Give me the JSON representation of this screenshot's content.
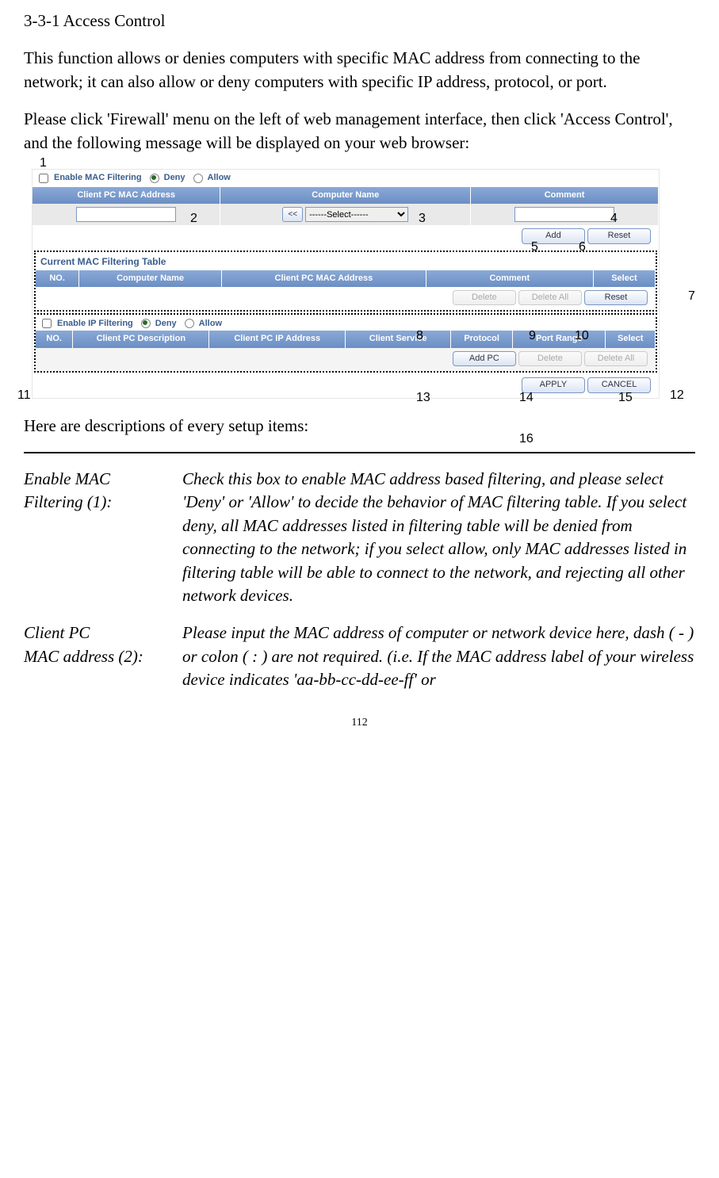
{
  "heading": "3-3-1 Access Control",
  "para1": "This function allows or denies computers with specific MAC address from connecting to the network; it can also allow or deny computers with specific IP address, protocol, or port.",
  "para2": "Please click 'Firewall' menu on the left of web management interface, then click 'Access Control', and the following message will be displayed on your web browser:",
  "para3": "Here are descriptions of every setup items:",
  "ui": {
    "macFilter": {
      "enableLabel": "Enable MAC Filtering",
      "deny": "Deny",
      "allow": "Allow",
      "headers": [
        "Client PC MAC Address",
        "Computer Name",
        "Comment"
      ],
      "selectPlaceholder": "------Select------",
      "arrow": "<<",
      "addBtn": "Add",
      "resetBtn": "Reset"
    },
    "macTable": {
      "title": "Current MAC Filtering Table",
      "headers": [
        "NO.",
        "Computer Name",
        "Client PC MAC Address",
        "Comment",
        "Select"
      ],
      "deleteBtn": "Delete",
      "deleteAllBtn": "Delete All",
      "resetBtn": "Reset"
    },
    "ipFilter": {
      "enableLabel": "Enable IP Filtering",
      "deny": "Deny",
      "allow": "Allow",
      "headers": [
        "NO.",
        "Client PC Description",
        "Client PC IP Address",
        "Client Service",
        "Protocol",
        "Port Range",
        "Select"
      ],
      "addPcBtn": "Add PC",
      "deleteBtn": "Delete",
      "deleteAllBtn": "Delete All"
    },
    "applyBtn": "APPLY",
    "cancelBtn": "CANCEL"
  },
  "callouts": {
    "c1": "1",
    "c2": "2",
    "c3": "3",
    "c4": "4",
    "c5": "5",
    "c6": "6",
    "c7": "7",
    "c8": "8",
    "c9": "9",
    "c10": "10",
    "c11": "11",
    "c12": "12",
    "c13": "13",
    "c14": "14",
    "c15": "15",
    "c16": "16"
  },
  "items": [
    {
      "name": "Enable MAC Filtering (1):",
      "nameLines": [
        "Enable MAC",
        "Filtering (1):"
      ],
      "desc": "Check this box to enable MAC address based filtering, and please select 'Deny' or 'Allow' to decide the behavior of MAC filtering table. If you select deny, all MAC addresses listed in filtering table will be denied from connecting to the network; if you select allow, only MAC addresses listed in filtering table will be able to connect to the network, and rejecting all other network devices."
    },
    {
      "name": "Client PC MAC address (2):",
      "nameLines": [
        "Client PC",
        "MAC address (2):"
      ],
      "desc": "Please input the MAC address of computer or network device here, dash ( - ) or colon ( : ) are not required. (i.e. If the MAC address label of your wireless device indicates 'aa-bb-cc-dd-ee-ff' or"
    }
  ],
  "pageNumber": "112"
}
